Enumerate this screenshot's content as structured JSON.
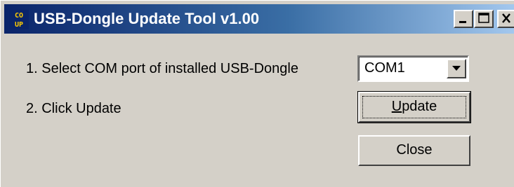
{
  "window": {
    "title": "USB-Dongle Update Tool v1.00",
    "icon": "com-up-app-icon"
  },
  "titlebar_buttons": {
    "minimize_icon": "minimize-icon",
    "maximize_icon": "maximize-icon",
    "close_icon": "close-x-icon"
  },
  "steps": {
    "step1": "1. Select COM port of installed USB-Dongle",
    "step2": "2. Click Update"
  },
  "com_port": {
    "selected": "COM1"
  },
  "buttons": {
    "update_first": "U",
    "update_rest": "pdate",
    "close": "Close"
  },
  "colors": {
    "titlebar_start": "#0a246a",
    "titlebar_end": "#a6caf0",
    "dialog_bg": "#d4d0c8"
  }
}
